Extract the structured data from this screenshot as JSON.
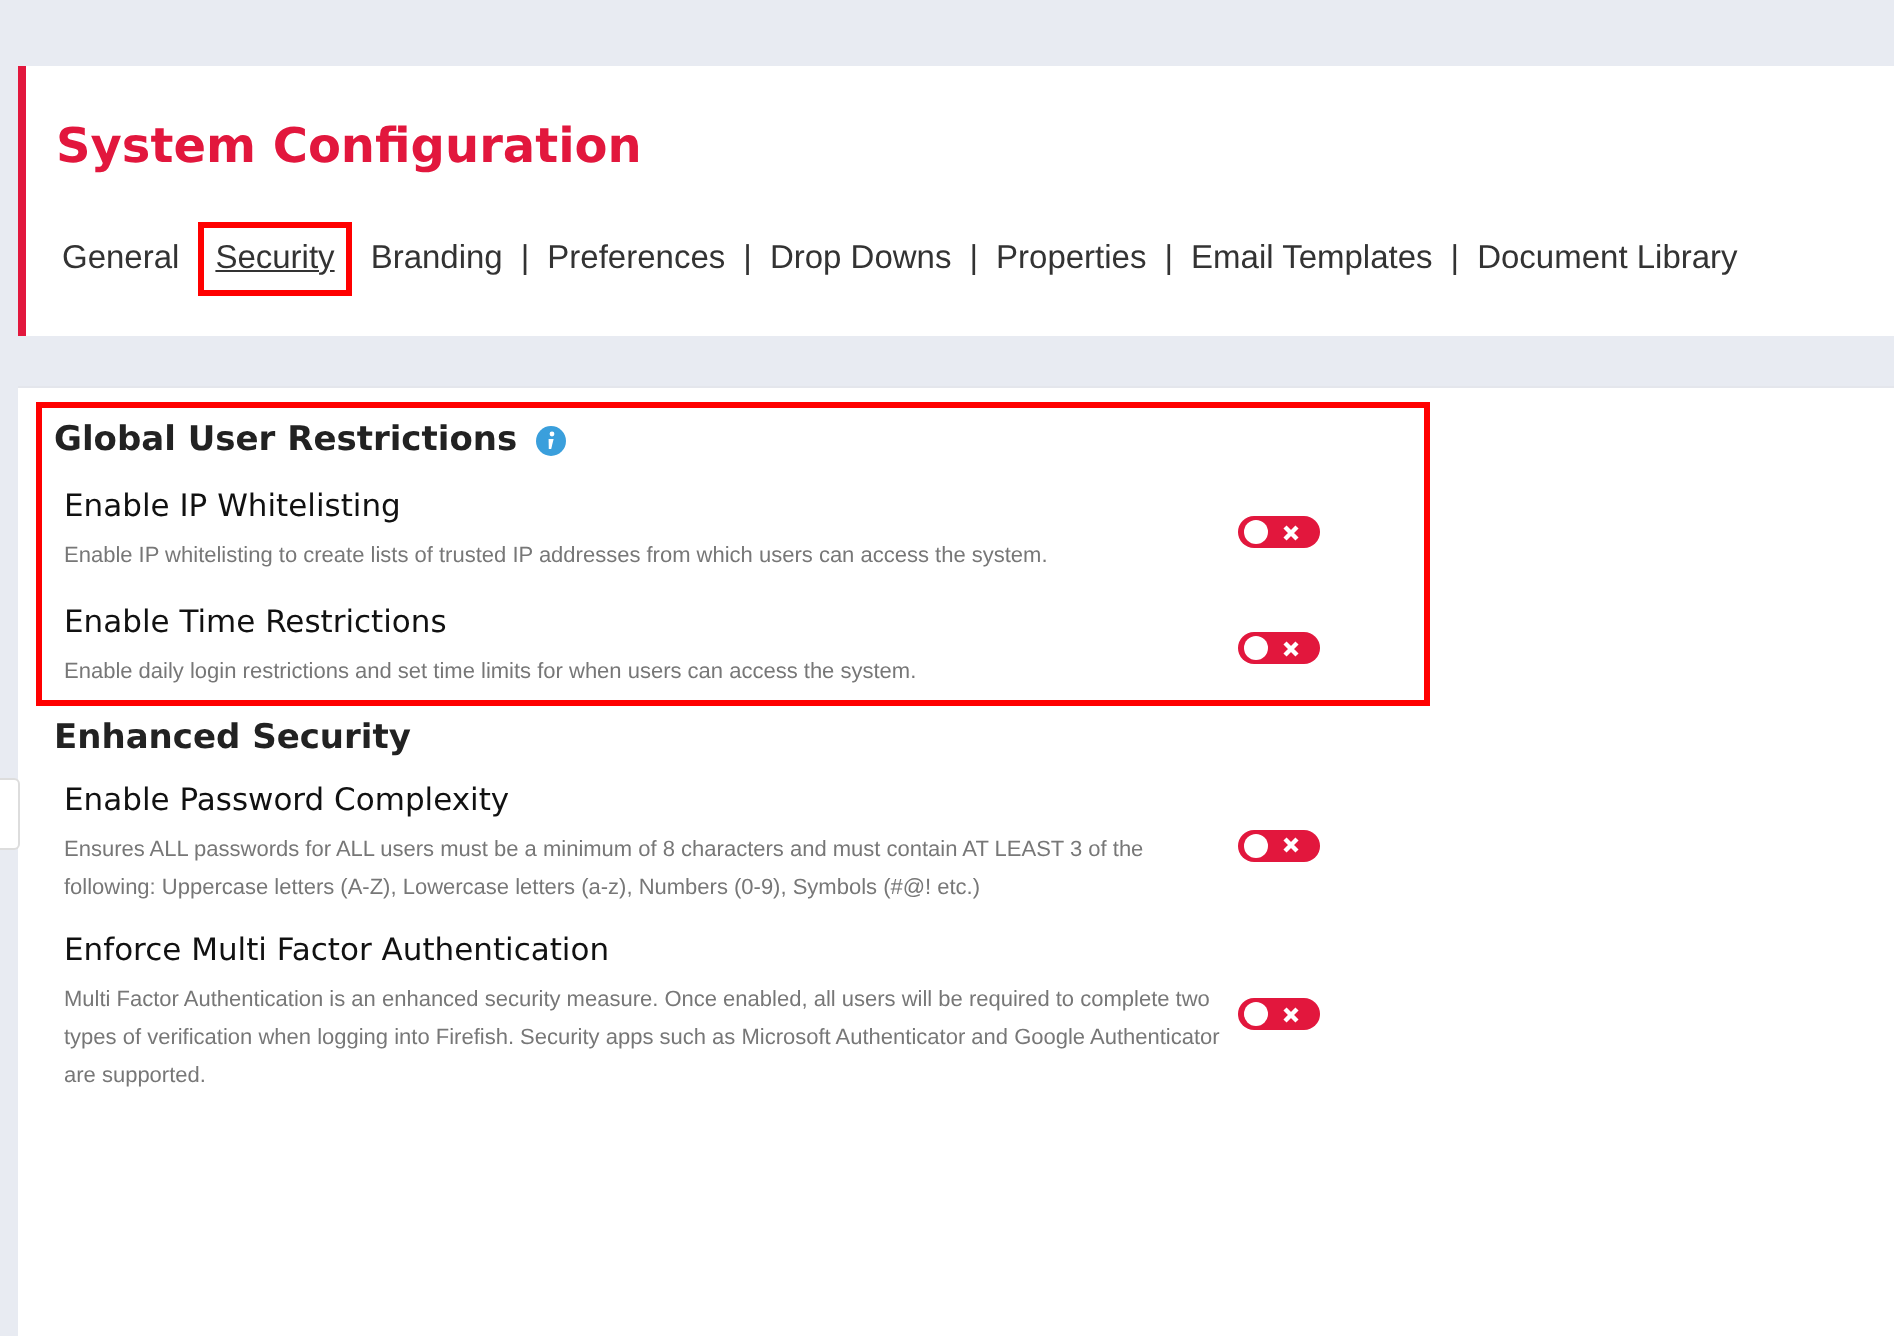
{
  "page_title": "System Configuration",
  "tabs": [
    {
      "label": "General",
      "selected": false,
      "highlighted": false
    },
    {
      "label": "Security",
      "selected": true,
      "highlighted": true
    },
    {
      "label": "Branding",
      "selected": false,
      "highlighted": false,
      "separator": "|"
    },
    {
      "label": "Preferences",
      "selected": false,
      "highlighted": false,
      "separator": "|"
    },
    {
      "label": "Drop Downs",
      "selected": false,
      "highlighted": false,
      "separator": "|"
    },
    {
      "label": "Properties",
      "selected": false,
      "highlighted": false,
      "separator": "|"
    },
    {
      "label": "Email Templates",
      "selected": false,
      "highlighted": false,
      "separator": "|"
    },
    {
      "label": "Document Library",
      "selected": false,
      "highlighted": false
    }
  ],
  "sections": [
    {
      "title": "Global User Restrictions",
      "info": true,
      "highlighted": true,
      "settings": [
        {
          "name": "Enable IP Whitelisting",
          "description": "Enable IP whitelisting to create lists of trusted IP addresses from which users can access the system.",
          "on": false
        },
        {
          "name": "Enable Time Restrictions",
          "description": "Enable daily login restrictions and set time limits for when users can access the system.",
          "on": false
        }
      ]
    },
    {
      "title": "Enhanced Security",
      "info": false,
      "highlighted": false,
      "settings": [
        {
          "name": "Enable Password Complexity",
          "description": "Ensures ALL passwords for ALL users must be a minimum of 8 characters and must contain AT LEAST 3 of the following: Uppercase letters (A-Z), Lowercase letters (a-z), Numbers (0-9), Symbols (#@! etc.)",
          "on": false
        },
        {
          "name": "Enforce Multi Factor Authentication",
          "description": "Multi Factor Authentication is an enhanced security measure. Once enabled, all users will be required to complete two types of verification when logging into Firefish. Security apps such as Microsoft Authenticator and Google Authenticator are supported.",
          "on": false
        }
      ]
    }
  ]
}
